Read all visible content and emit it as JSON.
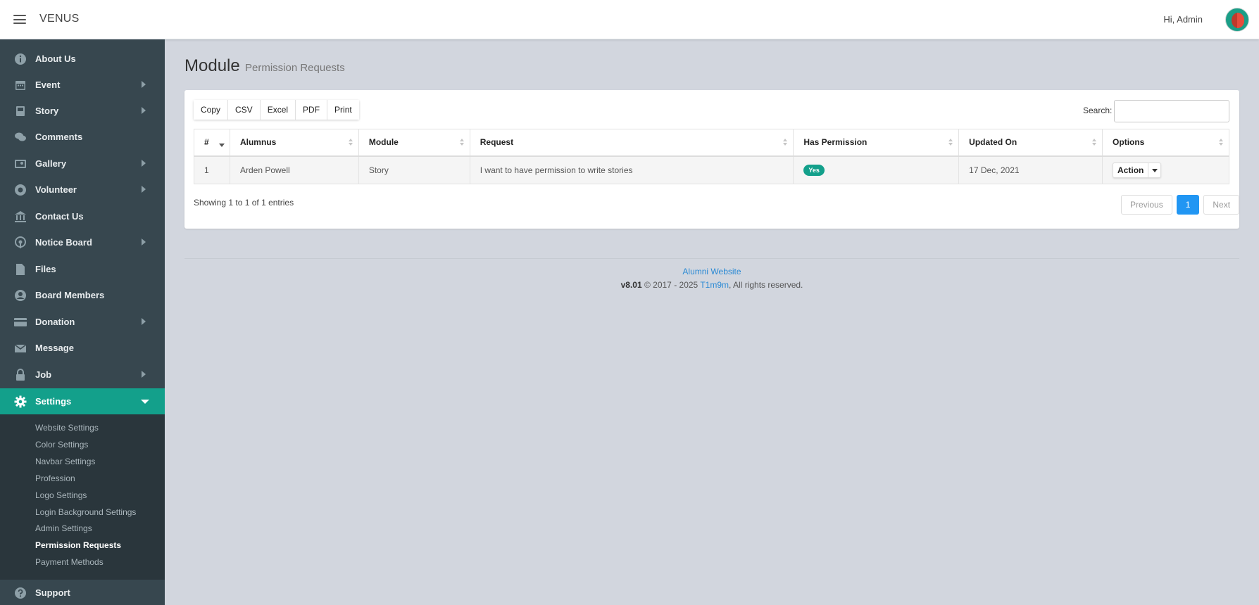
{
  "topbar": {
    "brand": "VENUS",
    "greeting": "Hi, Admin"
  },
  "sidebar": {
    "items": [
      {
        "label": "About Us",
        "icon": "info-icon",
        "has_children": false
      },
      {
        "label": "Event",
        "icon": "calendar-icon",
        "has_children": true
      },
      {
        "label": "Story",
        "icon": "book-icon",
        "has_children": true
      },
      {
        "label": "Comments",
        "icon": "comments-icon",
        "has_children": false
      },
      {
        "label": "Gallery",
        "icon": "image-icon",
        "has_children": true
      },
      {
        "label": "Volunteer",
        "icon": "lifebuoy-icon",
        "has_children": true
      },
      {
        "label": "Contact Us",
        "icon": "bank-icon",
        "has_children": false
      },
      {
        "label": "Notice Board",
        "icon": "podcast-icon",
        "has_children": true
      },
      {
        "label": "Files",
        "icon": "file-icon",
        "has_children": false
      },
      {
        "label": "Board Members",
        "icon": "user-circle-icon",
        "has_children": false
      },
      {
        "label": "Donation",
        "icon": "credit-card-icon",
        "has_children": true
      },
      {
        "label": "Message",
        "icon": "envelope-icon",
        "has_children": false
      },
      {
        "label": "Job",
        "icon": "lock-icon",
        "has_children": true
      },
      {
        "label": "Settings",
        "icon": "gear-icon",
        "has_children": true,
        "active": true
      }
    ],
    "settings_submenu": [
      "Website Settings",
      "Color Settings",
      "Navbar Settings",
      "Profession",
      "Logo Settings",
      "Login Background Settings",
      "Admin Settings",
      "Permission Requests",
      "Payment Methods"
    ],
    "current_submenu": "Permission Requests",
    "support_label": "Support"
  },
  "page": {
    "title": "Module",
    "subtitle": "Permission Requests"
  },
  "toolbar": {
    "buttons": [
      "Copy",
      "CSV",
      "Excel",
      "PDF",
      "Print"
    ],
    "search_label": "Search:",
    "search_value": ""
  },
  "table": {
    "columns": [
      "#",
      "Alumnus",
      "Module",
      "Request",
      "Has Permission",
      "Updated On",
      "Options"
    ],
    "rows": [
      {
        "num": "1",
        "alumnus": "Arden Powell",
        "module": "Story",
        "request": "I want to have permission to write stories",
        "has_permission": "Yes",
        "updated_on": "17 Dec, 2021",
        "option_label": "Action"
      }
    ]
  },
  "pagination": {
    "info": "Showing 1 to 1 of 1 entries",
    "previous": "Previous",
    "current": "1",
    "next": "Next"
  },
  "footer": {
    "site_link": "Alumni Website",
    "version": "v8.01",
    "copyright": "© 2017 - 2025",
    "author_link": "T1m9m",
    "rights": ", All rights reserved."
  },
  "colors": {
    "accent": "#13a08b",
    "sidebar": "#37474f",
    "pagination_active": "#2196f3"
  }
}
